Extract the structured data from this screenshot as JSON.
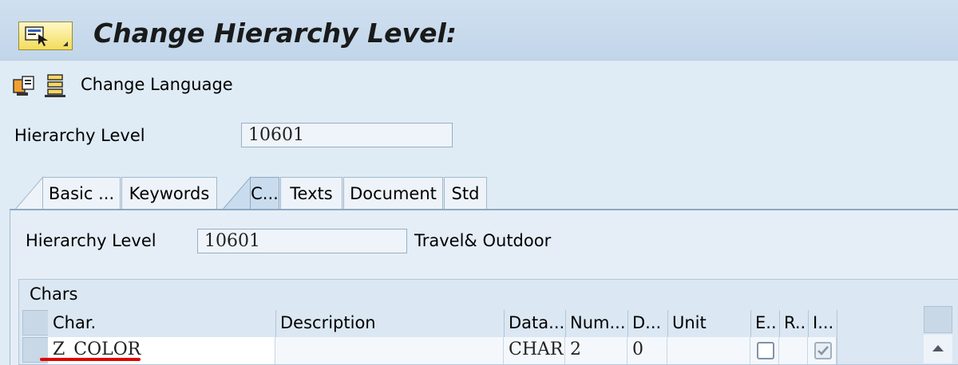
{
  "window": {
    "title": "Change Hierarchy Level:"
  },
  "menu_button": {
    "icon": "sap-menu-icon"
  },
  "toolbar": {
    "icons": [
      "copy-icon",
      "hierarchy-icon"
    ],
    "change_language_label": "Change Language"
  },
  "header": {
    "hierarchy_level_label": "Hierarchy Level",
    "hierarchy_level_value": "10601"
  },
  "tabs": [
    {
      "label": "Basic ...",
      "active": false
    },
    {
      "label": "Keywords",
      "active": false
    },
    {
      "label": "C...",
      "active": true
    },
    {
      "label": "Texts",
      "active": false
    },
    {
      "label": "Document",
      "active": false
    },
    {
      "label": "Std",
      "active": false
    }
  ],
  "panel": {
    "hierarchy_level_label": "Hierarchy Level",
    "hierarchy_level_value": "10601",
    "hierarchy_level_desc": "Travel& Outdoor"
  },
  "chars_table": {
    "title": "Chars",
    "columns": [
      "Char.",
      "Description",
      "Data...",
      "Num...",
      "D...",
      "Unit",
      "E..",
      "R..",
      "I..."
    ],
    "rows": [
      {
        "char": "Z_COLOR",
        "description": "",
        "data_type": "CHAR",
        "num": "2",
        "dec": "0",
        "unit": "",
        "e": false,
        "r": null,
        "i": true
      }
    ]
  },
  "colors": {
    "accent_underline": "#e00000",
    "background": "#dfebf5"
  }
}
